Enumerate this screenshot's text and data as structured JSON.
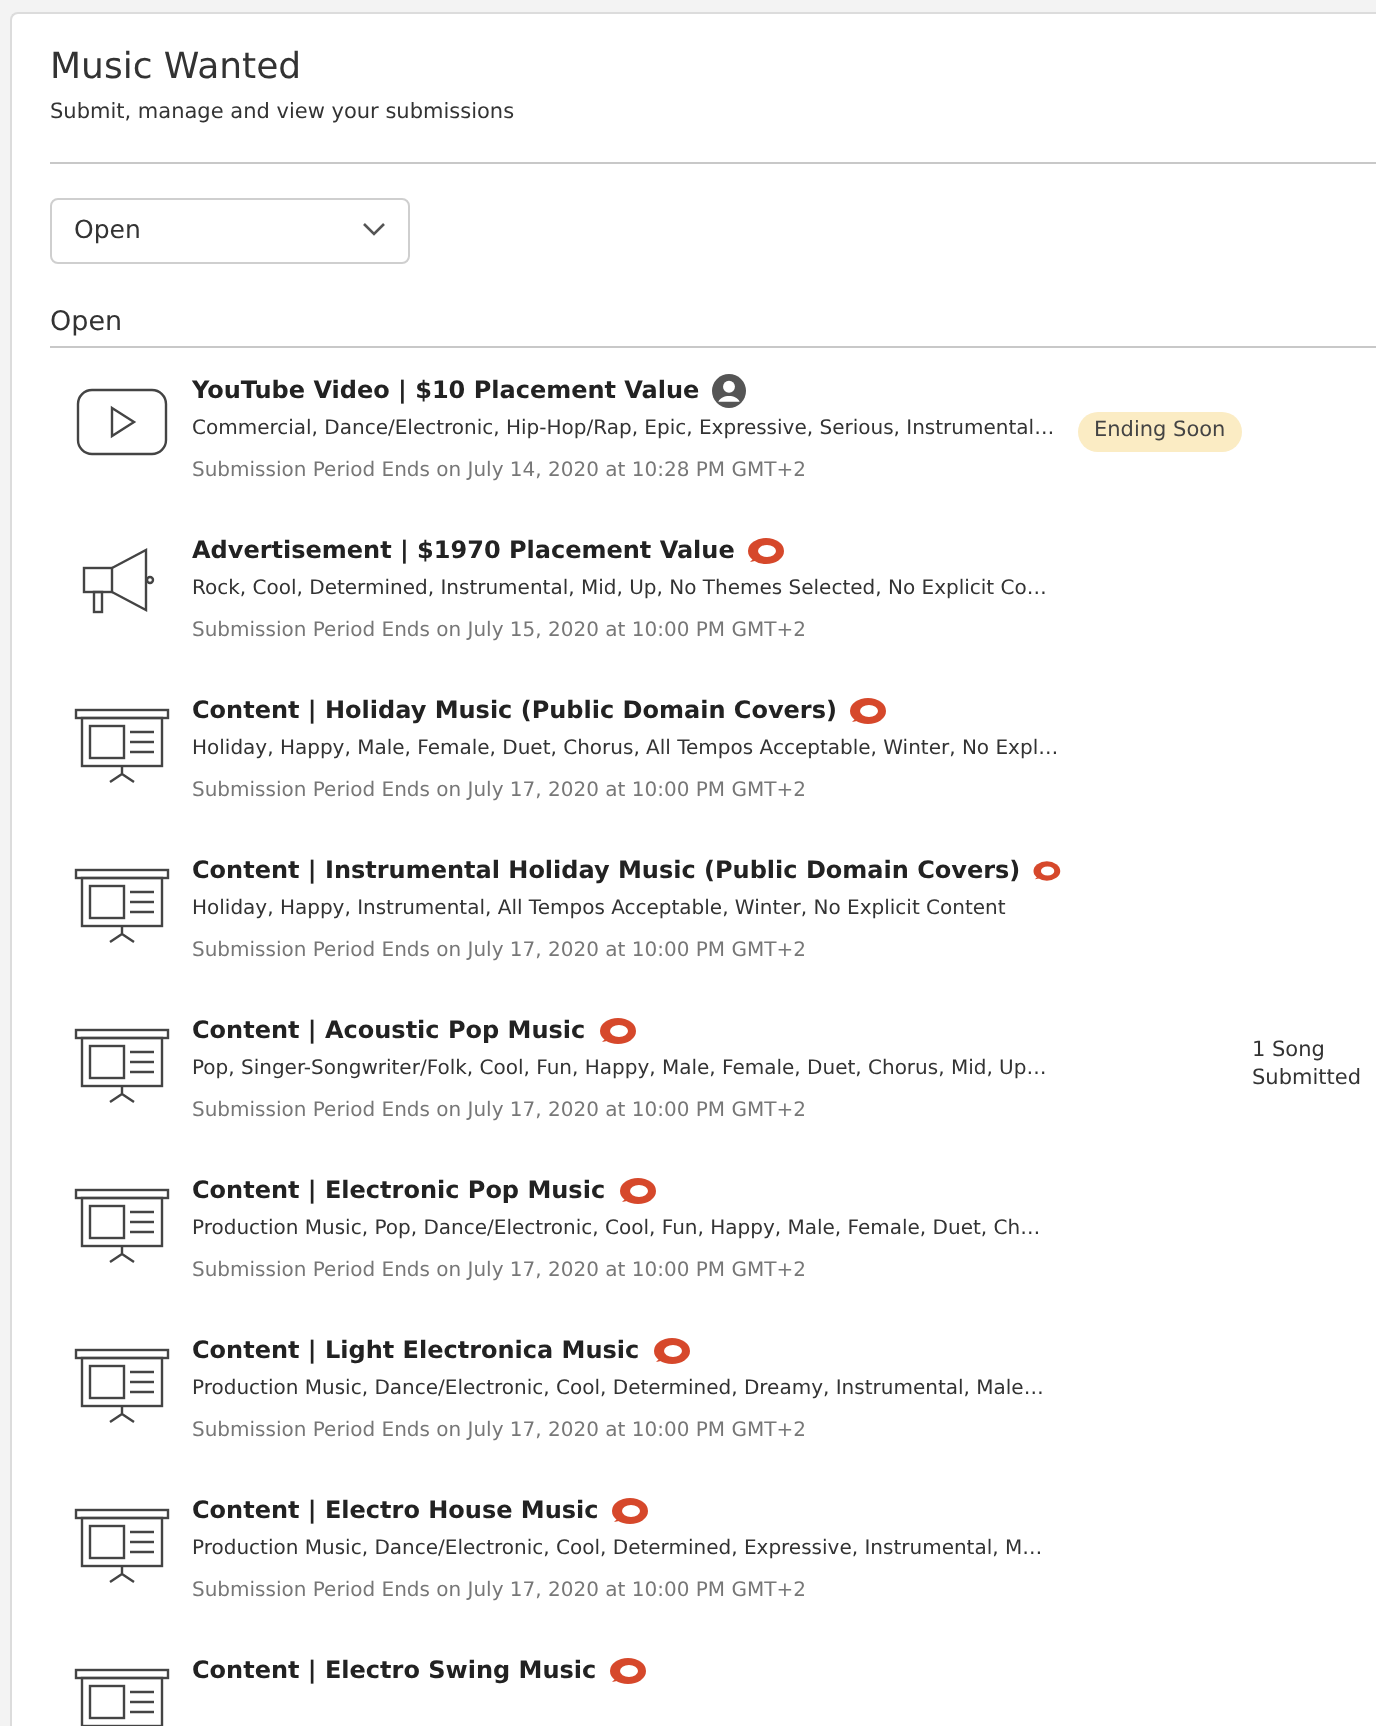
{
  "header": {
    "title": "Music Wanted",
    "subtitle": "Submit, manage and view your submissions"
  },
  "filter": {
    "value": "Open"
  },
  "section": {
    "title": "Open"
  },
  "items": [
    {
      "kind": "video",
      "title": "YouTube Video | $10 Placement Value",
      "tags": "Commercial, Dance/Electronic, Hip-Hop/Rap, Epic, Expressive, Serious, Instrumental…",
      "deadline": "Submission Period Ends on July 14, 2020 at 10:28 PM GMT+2",
      "status": "Ending Soon"
    },
    {
      "kind": "advertisement",
      "title": "Advertisement | $1970 Placement Value",
      "tags": "Rock, Cool, Determined, Instrumental, Mid, Up, No Themes Selected, No Explicit Co…",
      "deadline": "Submission Period Ends on July 15, 2020 at 10:00 PM GMT+2"
    },
    {
      "kind": "content",
      "title": "Content | Holiday Music (Public Domain Covers)",
      "tags": "Holiday, Happy, Male, Female, Duet, Chorus, All Tempos Acceptable, Winter, No Expl…",
      "deadline": "Submission Period Ends on July 17, 2020 at 10:00 PM GMT+2"
    },
    {
      "kind": "content",
      "title": "Content | Instrumental Holiday Music (Public Domain Covers)",
      "tags": "Holiday, Happy, Instrumental, All Tempos Acceptable, Winter, No Explicit Content",
      "deadline": "Submission Period Ends on July 17, 2020 at 10:00 PM GMT+2"
    },
    {
      "kind": "content",
      "title": "Content | Acoustic Pop Music",
      "tags": "Pop, Singer-Songwriter/Folk, Cool, Fun, Happy, Male, Female, Duet, Chorus, Mid, Up…",
      "deadline": "Submission Period Ends on July 17, 2020 at 10:00 PM GMT+2",
      "note": "1 Song Submitted"
    },
    {
      "kind": "content",
      "title": "Content | Electronic Pop Music",
      "tags": "Production Music, Pop, Dance/Electronic, Cool, Fun, Happy, Male, Female, Duet, Ch…",
      "deadline": "Submission Period Ends on July 17, 2020 at 10:00 PM GMT+2"
    },
    {
      "kind": "content",
      "title": "Content | Light Electronica Music",
      "tags": "Production Music, Dance/Electronic, Cool, Determined, Dreamy, Instrumental, Male…",
      "deadline": "Submission Period Ends on July 17, 2020 at 10:00 PM GMT+2"
    },
    {
      "kind": "content",
      "title": "Content | Electro House Music",
      "tags": "Production Music, Dance/Electronic, Cool, Determined, Expressive, Instrumental, M…",
      "deadline": "Submission Period Ends on July 17, 2020 at 10:00 PM GMT+2"
    },
    {
      "kind": "content",
      "title": "Content | Electro Swing Music"
    }
  ]
}
